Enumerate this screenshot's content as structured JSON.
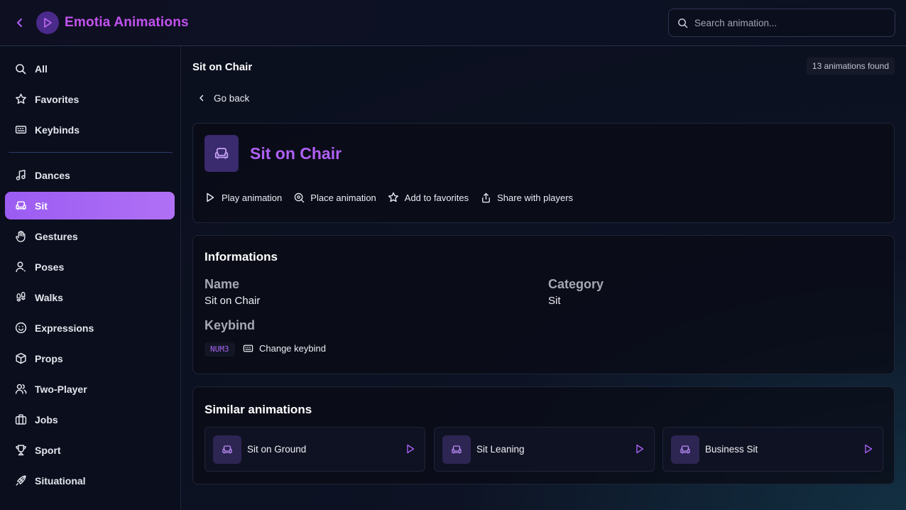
{
  "app": {
    "title": "Emotia Animations"
  },
  "search": {
    "placeholder": "Search animation..."
  },
  "sidebar": {
    "items": [
      {
        "label": "All",
        "icon": "search-icon"
      },
      {
        "label": "Favorites",
        "icon": "star-icon"
      },
      {
        "label": "Keybinds",
        "icon": "keyboard-icon"
      },
      {
        "label": "Dances",
        "icon": "music-note-icon"
      },
      {
        "label": "Sit",
        "icon": "armchair-icon",
        "active": true
      },
      {
        "label": "Gestures",
        "icon": "hand-icon"
      },
      {
        "label": "Poses",
        "icon": "person-icon"
      },
      {
        "label": "Walks",
        "icon": "footprints-icon"
      },
      {
        "label": "Expressions",
        "icon": "smile-icon"
      },
      {
        "label": "Props",
        "icon": "box-icon"
      },
      {
        "label": "Two-Player",
        "icon": "users-icon"
      },
      {
        "label": "Jobs",
        "icon": "briefcase-icon"
      },
      {
        "label": "Sport",
        "icon": "trophy-icon"
      },
      {
        "label": "Situational",
        "icon": "rocket-icon"
      }
    ]
  },
  "main": {
    "page_title": "Sit on Chair",
    "count_badge": "13 animations found",
    "go_back": "Go back"
  },
  "animation": {
    "title": "Sit on Chair",
    "icon": "armchair-icon",
    "actions": [
      {
        "label": "Play animation",
        "icon": "play-icon"
      },
      {
        "label": "Place animation",
        "icon": "place-icon"
      },
      {
        "label": "Add to favorites",
        "icon": "star-icon"
      },
      {
        "label": "Share with players",
        "icon": "share-icon"
      }
    ]
  },
  "info": {
    "title": "Informations",
    "name_label": "Name",
    "name_value": "Sit on Chair",
    "category_label": "Category",
    "category_value": "Sit",
    "keybind_label": "Keybind",
    "keybind_value": "NUM3",
    "change_keybind": "Change keybind"
  },
  "similar": {
    "title": "Similar animations",
    "items": [
      {
        "label": "Sit on Ground",
        "icon": "armchair-icon"
      },
      {
        "label": "Sit Leaning",
        "icon": "armchair-icon"
      },
      {
        "label": "Business Sit",
        "icon": "armchair-icon"
      }
    ]
  },
  "colors": {
    "accent": "#b060f5",
    "brand_title": "#c352f0",
    "active_nav": "#9b5cf2"
  }
}
